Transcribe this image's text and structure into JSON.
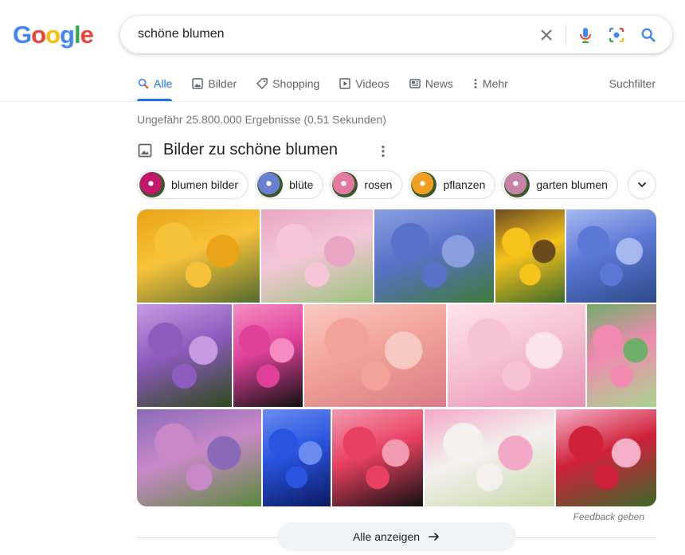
{
  "logo": {
    "letters": [
      "G",
      "o",
      "o",
      "g",
      "l",
      "e"
    ]
  },
  "search": {
    "query": "schöne blumen"
  },
  "tabs": [
    {
      "label": "Alle",
      "icon": "search-icon",
      "active": true
    },
    {
      "label": "Bilder",
      "icon": "image-icon"
    },
    {
      "label": "Shopping",
      "icon": "tag-icon"
    },
    {
      "label": "Videos",
      "icon": "play-icon"
    },
    {
      "label": "News",
      "icon": "news-icon"
    },
    {
      "label": "Mehr",
      "icon": "more-vert-icon"
    }
  ],
  "suchfilter": "Suchfilter",
  "result_stats": "Ungefähr 25.800.000 Ergebnisse (0,51 Sekunden)",
  "images_section": {
    "title": "Bilder zu schöne blumen",
    "chips": [
      {
        "label": "blumen bilder",
        "color": "#c2186b"
      },
      {
        "label": "blüte",
        "color": "#6a7fd0"
      },
      {
        "label": "rosen",
        "color": "#e27aa2"
      },
      {
        "label": "pflanzen",
        "color": "#f0a020"
      },
      {
        "label": "garten blumen",
        "color": "#c884a8"
      }
    ]
  },
  "image_tiles": [
    {
      "description": "sunflowers at sunset",
      "colors": [
        "#f7c23a",
        "#e8a317",
        "#556b2f"
      ]
    },
    {
      "description": "pink anemone",
      "colors": [
        "#f4c6d8",
        "#e8a6c4",
        "#9ac27a"
      ]
    },
    {
      "description": "blue hydrangeas",
      "colors": [
        "#5872c9",
        "#8a9ee0",
        "#3f7a3a"
      ]
    },
    {
      "description": "single sunflower",
      "colors": [
        "#f6c21c",
        "#6b4a1e",
        "#3e6b2a"
      ]
    },
    {
      "description": "blue delphinium",
      "colors": [
        "#5b78d6",
        "#a7b8ee",
        "#2e4a8a"
      ]
    },
    {
      "description": "purple clematis",
      "colors": [
        "#8e5bbf",
        "#c59ae0",
        "#2e4a1c"
      ]
    },
    {
      "description": "pink roses on black",
      "colors": [
        "#e0409a",
        "#f48cc2",
        "#111111"
      ]
    },
    {
      "description": "salmon roses with heart",
      "colors": [
        "#f2a29a",
        "#f7c9c2",
        "#d87c86"
      ]
    },
    {
      "description": "cherry blossoms",
      "colors": [
        "#f6c2d4",
        "#fde3ec",
        "#e892b2"
      ]
    },
    {
      "description": "pink lotus",
      "colors": [
        "#f08ab0",
        "#6fae6a",
        "#a8d48e"
      ]
    },
    {
      "description": "lupine field",
      "colors": [
        "#c888c8",
        "#8a6ab8",
        "#5a8a3a"
      ]
    },
    {
      "description": "blue dahlia",
      "colors": [
        "#2a54e0",
        "#6a8cf0",
        "#0a1a60"
      ]
    },
    {
      "description": "flower collage on black",
      "colors": [
        "#e84060",
        "#f29ab0",
        "#111111"
      ]
    },
    {
      "description": "cosmos sky",
      "colors": [
        "#f3f0ee",
        "#f4a8c8",
        "#c8d8a8"
      ]
    },
    {
      "description": "red and pink rose bouquet",
      "colors": [
        "#d0203a",
        "#f4b0c8",
        "#3a6a2a"
      ]
    }
  ],
  "feedback": "Feedback geben",
  "show_all": "Alle anzeigen"
}
